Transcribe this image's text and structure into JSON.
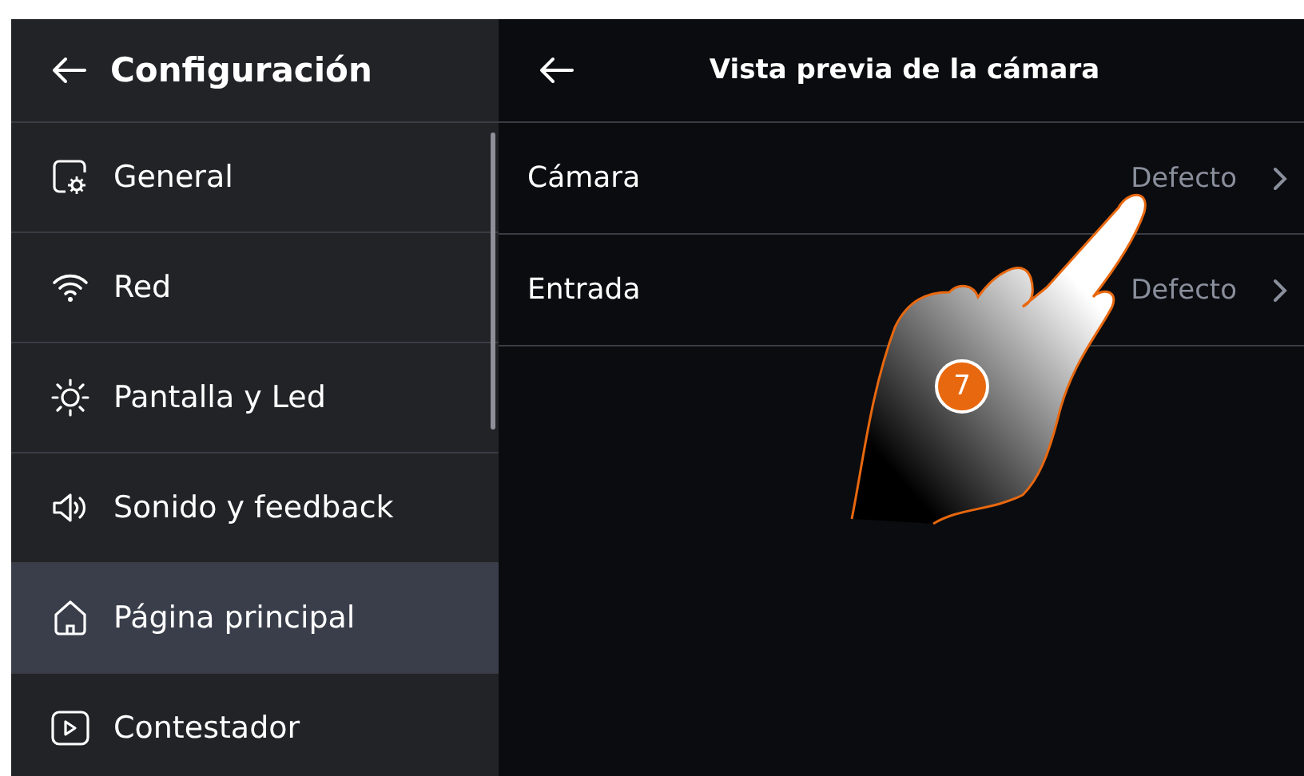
{
  "sidebar": {
    "title": "Configuración",
    "items": [
      {
        "kind": "general",
        "label": "General",
        "selected": false
      },
      {
        "kind": "network",
        "label": "Red",
        "selected": false
      },
      {
        "kind": "display",
        "label": "Pantalla y Led",
        "selected": false
      },
      {
        "kind": "sound",
        "label": "Sonido y feedback",
        "selected": false
      },
      {
        "kind": "home",
        "label": "Página principal",
        "selected": true
      },
      {
        "kind": "answering",
        "label": "Contestador",
        "selected": false
      }
    ]
  },
  "detail": {
    "title": "Vista previa de la cámara",
    "rows": [
      {
        "label": "Cámara",
        "value": "Defecto"
      },
      {
        "label": "Entrada",
        "value": "Defecto"
      }
    ]
  },
  "step_badge": "7"
}
